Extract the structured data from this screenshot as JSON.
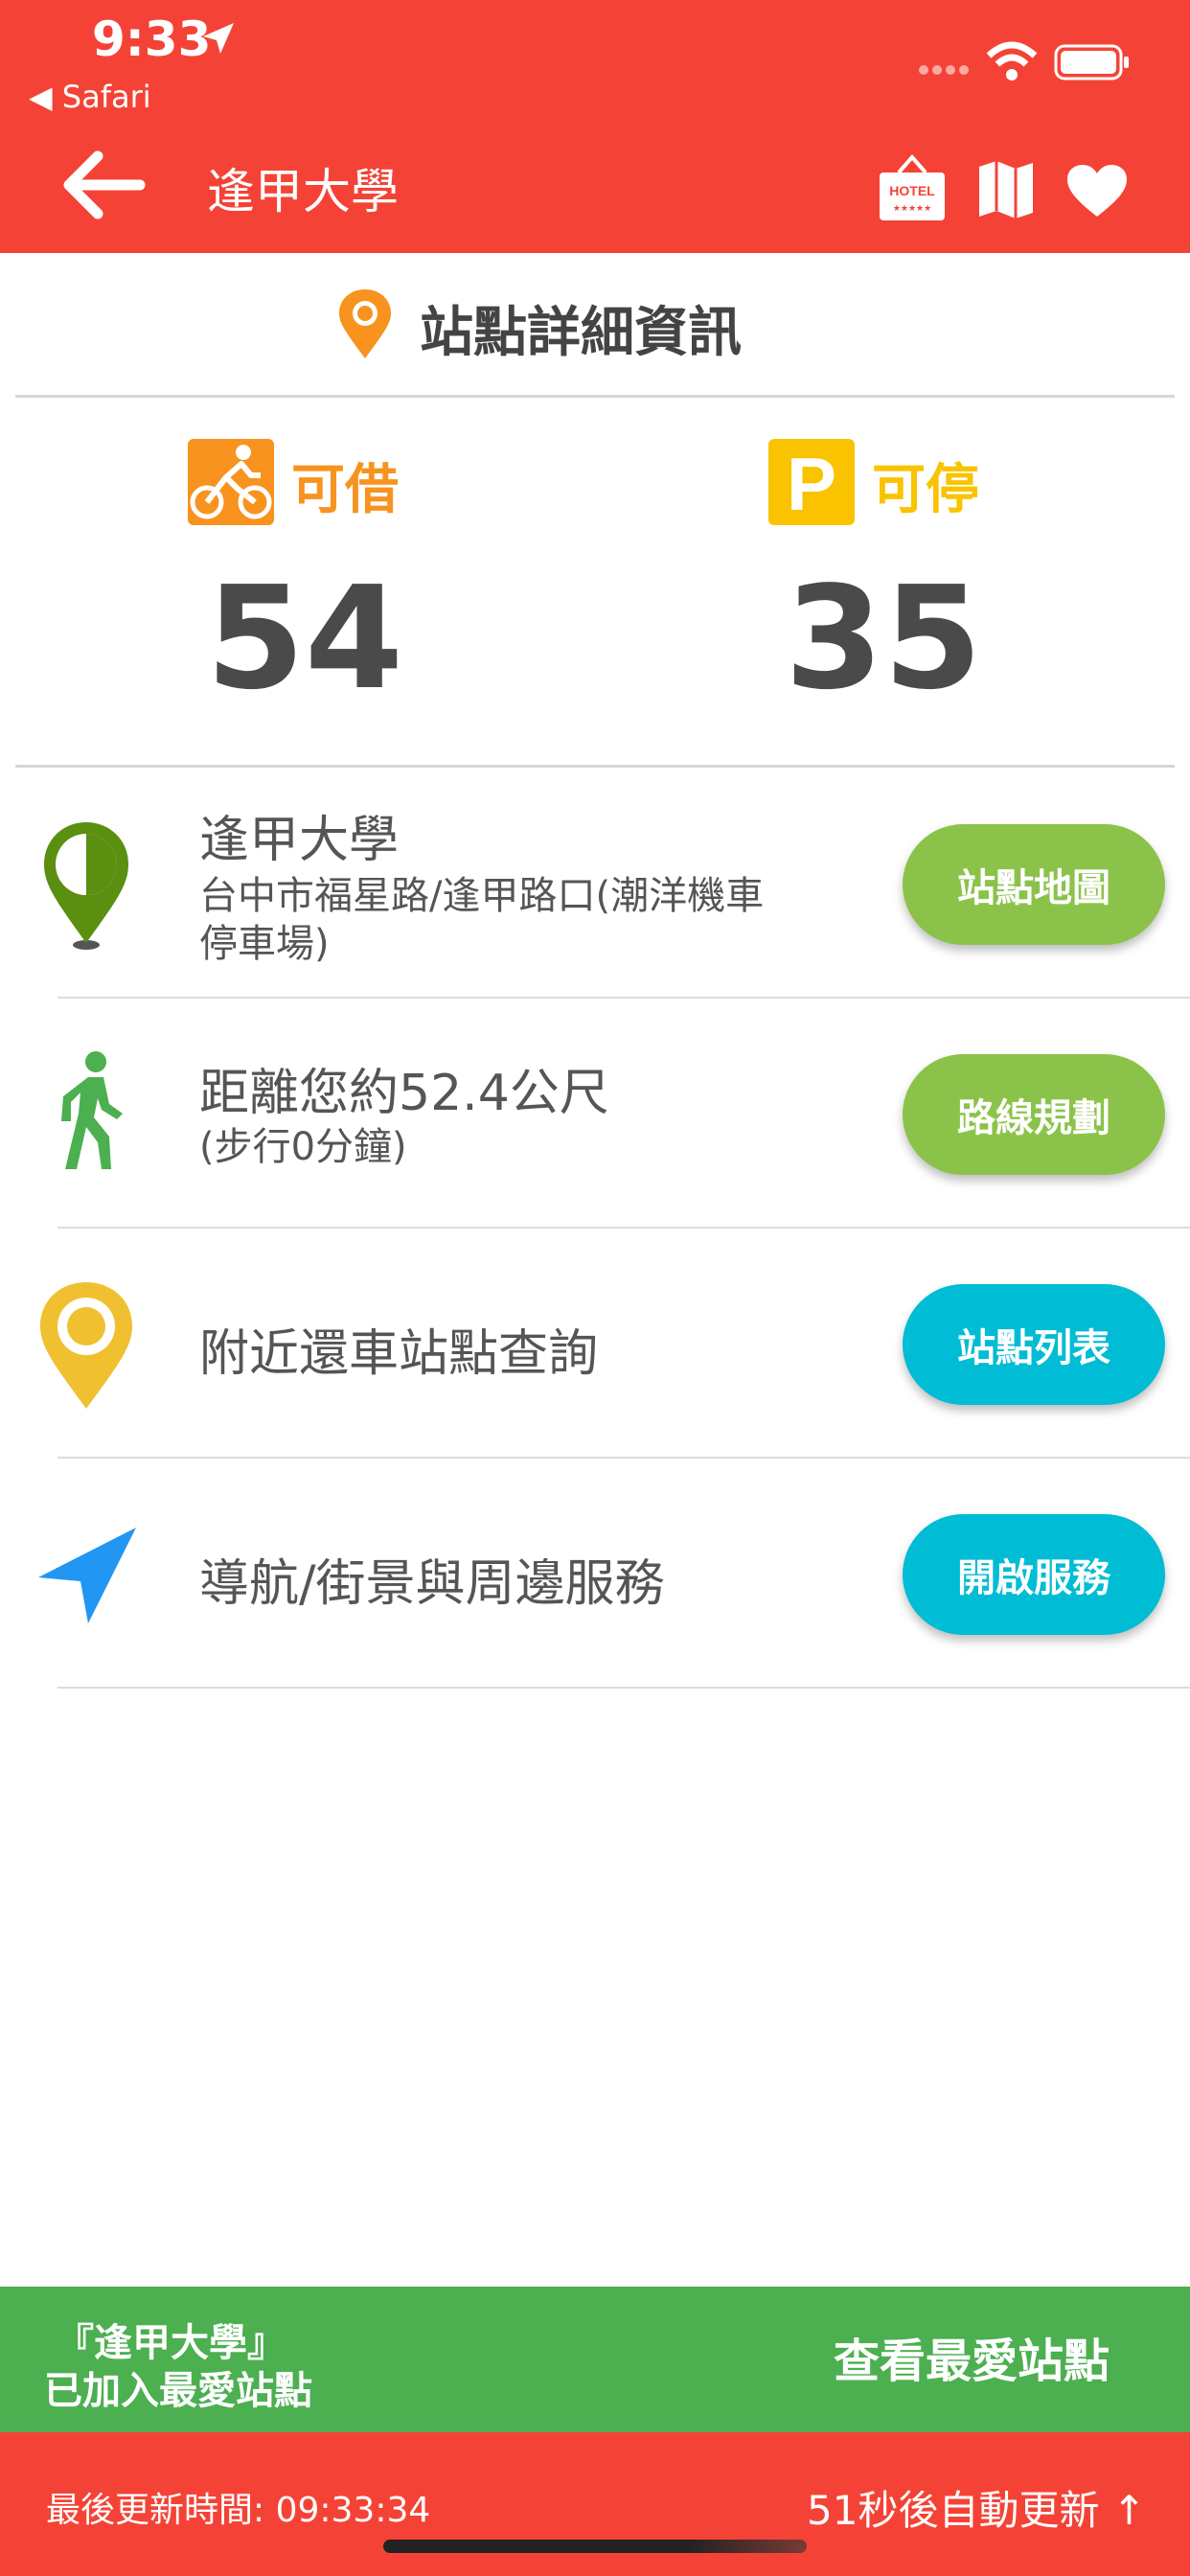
{
  "status_bar": {
    "time": "9:33",
    "back_app": "◀ Safari"
  },
  "nav": {
    "title": "逢甲大學",
    "hotel_icon_text": "HOTEL",
    "hotel_stars": "★★★★★"
  },
  "section": {
    "title": "站點詳細資訊"
  },
  "counts": {
    "rent_label": "可借",
    "rent_value": "54",
    "park_label": "可停",
    "park_value": "35",
    "park_icon_letter": "P"
  },
  "rows": [
    {
      "title": "逢甲大學",
      "sub1": "台中市福星路/逢甲路口(潮洋機車",
      "sub2": "停車場)",
      "button": "站點地圖"
    },
    {
      "title": "距離您約52.4公尺",
      "sub1": "(步行0分鐘)",
      "button": "路線規劃"
    },
    {
      "title": "附近還車站點查詢",
      "button": "站點列表"
    },
    {
      "title": "導航/街景與周邊服務",
      "button": "開啟服務"
    }
  ],
  "fav_bar": {
    "message_line1": "『逢甲大學』",
    "message_line2": "已加入最愛站點",
    "button": "查看最愛站點"
  },
  "update_bar": {
    "last_update": "最後更新時間:  09:33:34",
    "auto_refresh": "51秒後自動更新 ↑"
  },
  "colors": {
    "primary_red": "#f44336",
    "green": "#8bc34a",
    "cyan": "#00bcd4",
    "orange": "#f7931e",
    "yellow": "#f9c300"
  }
}
